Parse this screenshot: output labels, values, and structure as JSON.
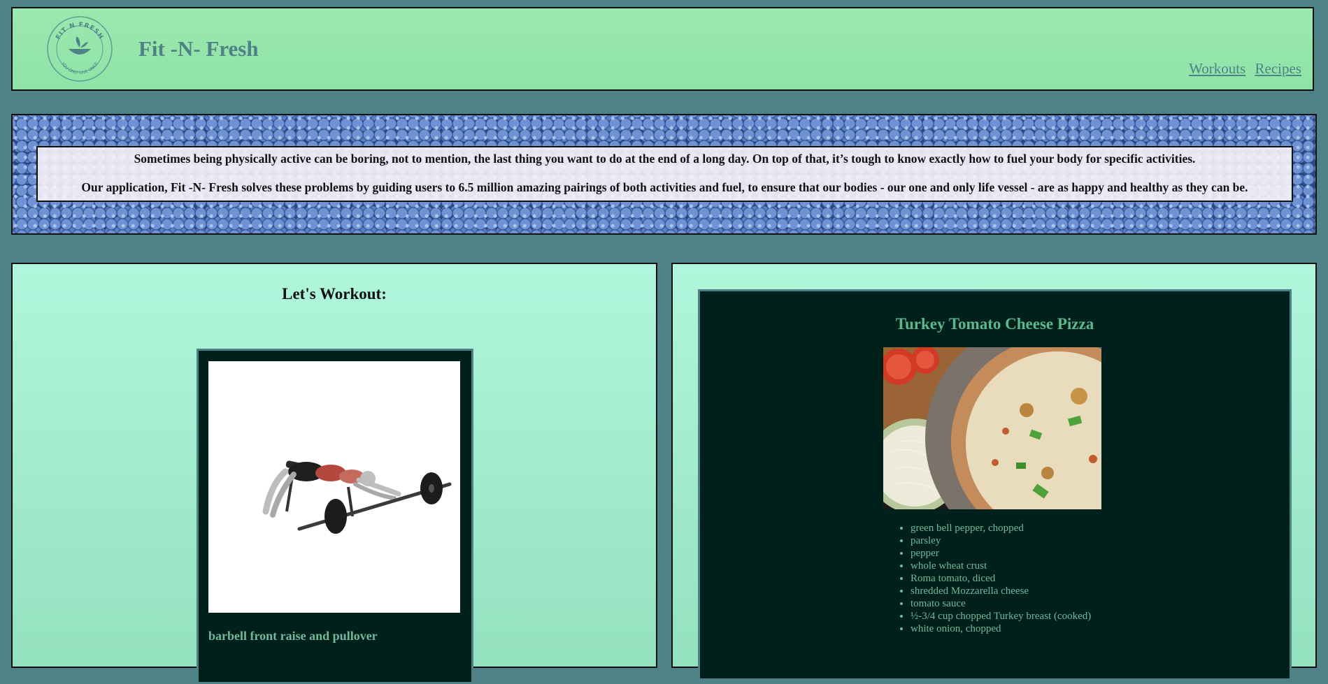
{
  "header": {
    "brand": "Fit -N- Fresh",
    "logo_text_top": "FIT N FRESH",
    "logo_text_bottom": "YOU ONLY LIVE ONCE",
    "nav": [
      {
        "label": "Workouts"
      },
      {
        "label": "Recipes"
      }
    ]
  },
  "banner": {
    "line1": "Sometimes being physically active can be boring, not to mention, the last thing you want to do at the end of a long day. On top of that, it’s tough to know exactly how to fuel your body for specific activities.",
    "line2": "Our application, Fit -N- Fresh solves these problems by guiding users to 6.5 million amazing pairings of both activities and fuel, to ensure that our bodies - our one and only life vessel - are as happy and healthy as they can be."
  },
  "workout": {
    "heading": "Let's Workout:",
    "name": "barbell front raise and pullover"
  },
  "recipe": {
    "title": "Turkey Tomato Cheese Pizza",
    "ingredients": [
      "green bell pepper, chopped",
      "parsley",
      "pepper",
      "whole wheat crust",
      "Roma tomato, diced",
      "shredded Mozzarella cheese",
      "tomato sauce",
      "½-3/4 cup chopped Turkey breast (cooked)",
      "white onion, chopped"
    ]
  },
  "colors": {
    "page_bg": "#4e8287",
    "header_bg": "#9ce8b0",
    "panel_bg": "#b0f6dc",
    "card_bg": "#00201c",
    "accent_text": "#71b99a"
  }
}
